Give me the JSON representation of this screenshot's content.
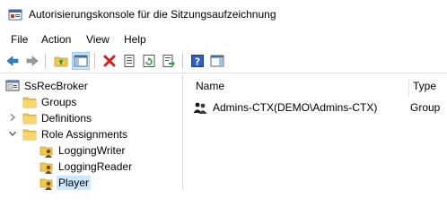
{
  "window": {
    "title": "Autorisierungskonsole für die Sitzungsaufzeichnung",
    "app_icon": "console-icon"
  },
  "menu": [
    {
      "label": "File"
    },
    {
      "label": "Action"
    },
    {
      "label": "View"
    },
    {
      "label": "Help"
    }
  ],
  "toolbar": [
    {
      "icon": "back-arrow-icon"
    },
    {
      "icon": "forward-arrow-icon"
    },
    {
      "icon": "up-folder-icon"
    },
    {
      "icon": "show-hide-tree-icon"
    },
    {
      "icon": "delete-icon"
    },
    {
      "icon": "properties-icon"
    },
    {
      "icon": "refresh-icon"
    },
    {
      "icon": "export-list-icon"
    },
    {
      "icon": "help-icon"
    },
    {
      "icon": "show-hide-action-pane-icon"
    }
  ],
  "tree": {
    "root": {
      "label": "SsRecBroker",
      "icon": "broker-icon"
    },
    "items": [
      {
        "label": "Groups",
        "icon": "folder-icon",
        "level": 1,
        "expander": "none"
      },
      {
        "label": "Definitions",
        "icon": "folder-icon",
        "level": 1,
        "expander": "collapsed"
      },
      {
        "label": "Role Assignments",
        "icon": "folder-icon",
        "level": 1,
        "expander": "expanded"
      },
      {
        "label": "LoggingWriter",
        "icon": "role-icon",
        "level": 2
      },
      {
        "label": "LoggingReader",
        "icon": "role-icon",
        "level": 2
      },
      {
        "label": "Player",
        "icon": "role-icon",
        "level": 2,
        "selected": true
      }
    ]
  },
  "list": {
    "columns": [
      "Name",
      "Type"
    ],
    "rows": [
      {
        "name": "Admins-CTX(DEMO\\Admins-CTX)",
        "type": "Group",
        "icon": "user-group-icon"
      }
    ]
  },
  "colors": {
    "selection": "#cce8ff",
    "toolbar_pressed": "#cce4f7",
    "folder": "#f3c84a"
  }
}
